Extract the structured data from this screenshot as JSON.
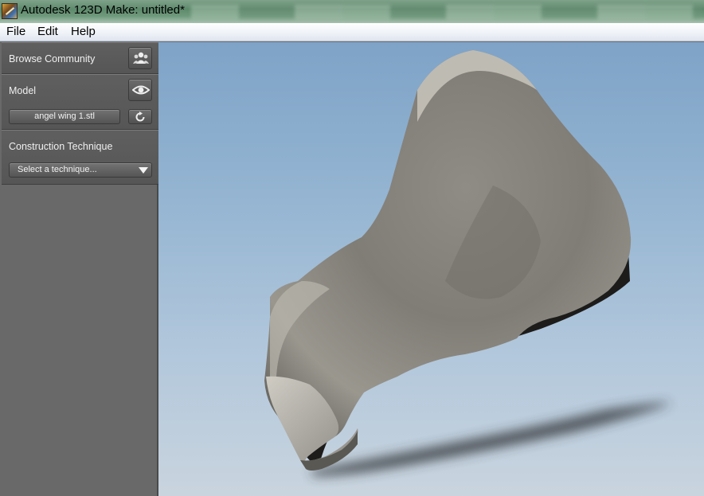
{
  "window": {
    "title": "Autodesk 123D Make: untitled*",
    "app_icon": "autodesk-123d-make-icon"
  },
  "menu": {
    "items": [
      "File",
      "Edit",
      "Help"
    ]
  },
  "sidebar": {
    "browse_community": {
      "label": "Browse Community",
      "icon": "community-people-icon"
    },
    "model": {
      "label": "Model",
      "visibility_icon": "eye-icon",
      "file_name": "angel wing 1.stl",
      "reload_icon": "refresh-icon"
    },
    "construction": {
      "label": "Construction Technique",
      "select_value": "Select a technique...",
      "dropdown_icon": "chevron-down-icon"
    }
  },
  "viewport": {
    "model_name": "angel wing 1.stl"
  },
  "colors": {
    "sidebar_bg": "#696969",
    "panel_bg": "#5a5a5a",
    "sky_top": "#7ea3c7",
    "sky_bottom": "#c9d4de",
    "model_gray": "#8e8c86"
  }
}
